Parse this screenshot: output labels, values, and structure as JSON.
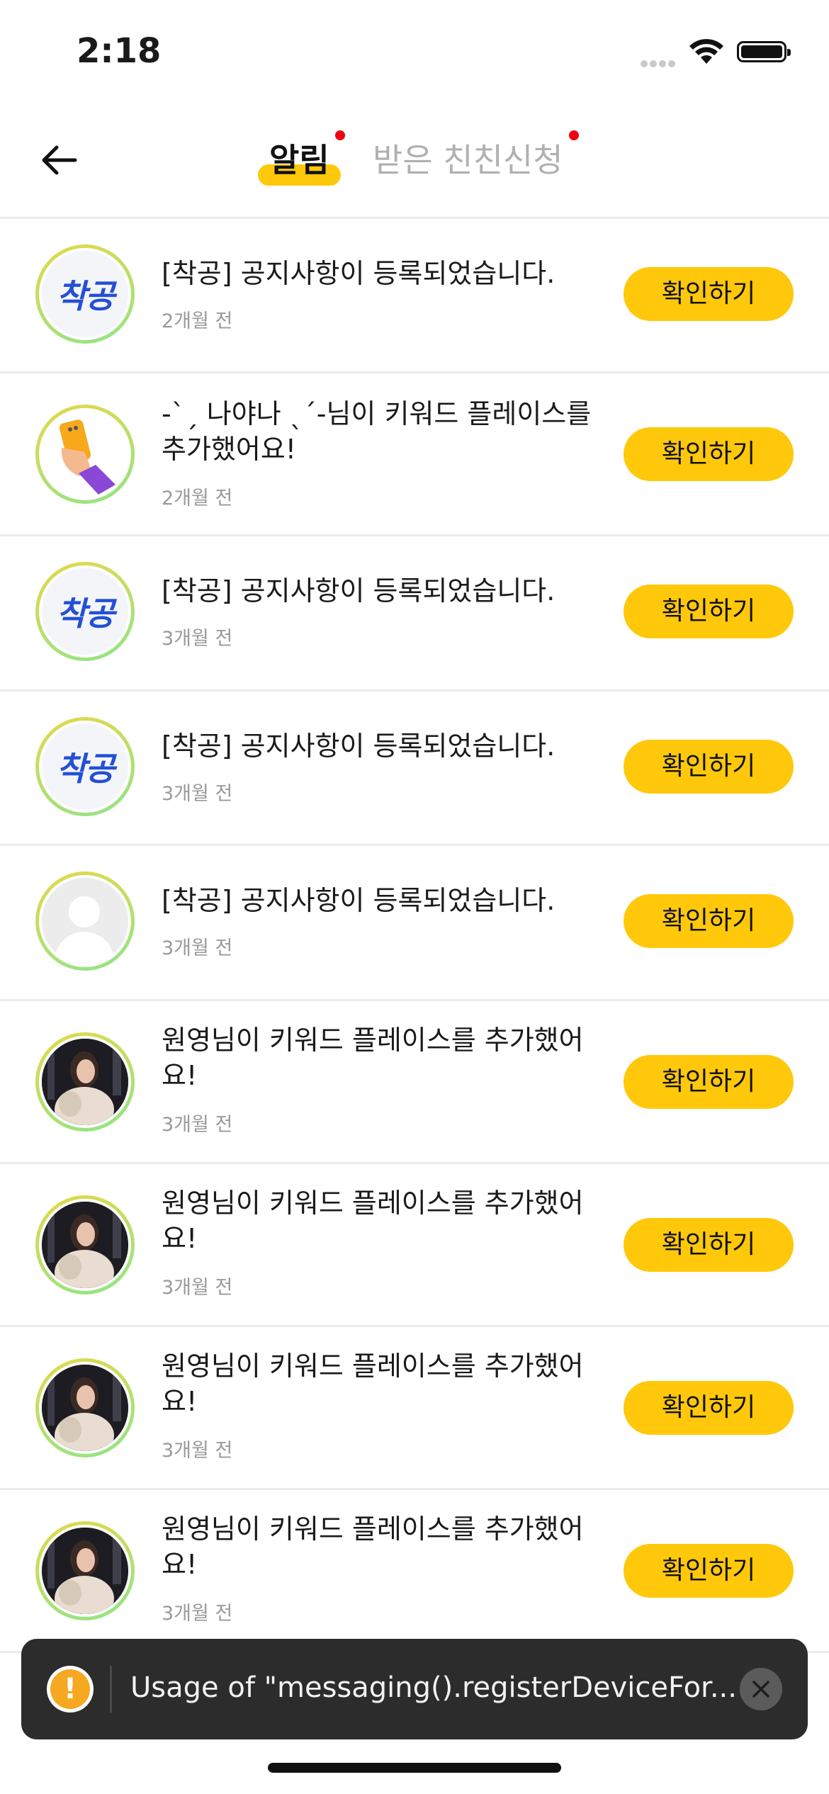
{
  "status_bar": {
    "time": "2:18"
  },
  "header": {
    "tabs": [
      {
        "label": "알림",
        "active": true,
        "badge": true
      },
      {
        "label": "받은 친친신청",
        "active": false,
        "badge": true
      }
    ]
  },
  "colors": {
    "accent": "#ffc80a",
    "badge": "#f00010",
    "logo_blue": "#2450d6"
  },
  "notifications": [
    {
      "avatar": "logo",
      "logo_text": "착공",
      "message": "[착공] 공지사항이 등록되었습니다.",
      "time": "2개월 전",
      "action": "확인하기"
    },
    {
      "avatar": "phone-emoji",
      "message": "-ˋˏ 나야나 ˎˊ-님이 키워드 플레이스를 추가했어요!",
      "time": "2개월 전",
      "action": "확인하기"
    },
    {
      "avatar": "logo",
      "logo_text": "착공",
      "message": "[착공] 공지사항이 등록되었습니다.",
      "time": "3개월 전",
      "action": "확인하기"
    },
    {
      "avatar": "logo",
      "logo_text": "착공",
      "message": "[착공] 공지사항이 등록되었습니다.",
      "time": "3개월 전",
      "action": "확인하기"
    },
    {
      "avatar": "default",
      "message": "[착공] 공지사항이 등록되었습니다.",
      "time": "3개월 전",
      "action": "확인하기"
    },
    {
      "avatar": "photo",
      "message": "원영님이 키워드 플레이스를 추가했어요!",
      "time": "3개월 전",
      "action": "확인하기"
    },
    {
      "avatar": "photo",
      "message": "원영님이 키워드 플레이스를 추가했어요!",
      "time": "3개월 전",
      "action": "확인하기"
    },
    {
      "avatar": "photo",
      "message": "원영님이 키워드 플레이스를 추가했어요!",
      "time": "3개월 전",
      "action": "확인하기"
    },
    {
      "avatar": "photo",
      "message": "원영님이 키워드 플레이스를 추가했어요!",
      "time": "3개월 전",
      "action": "확인하기"
    }
  ],
  "toast": {
    "icon": "warning-icon",
    "text": "Usage of \"messaging().registerDeviceFor..."
  }
}
